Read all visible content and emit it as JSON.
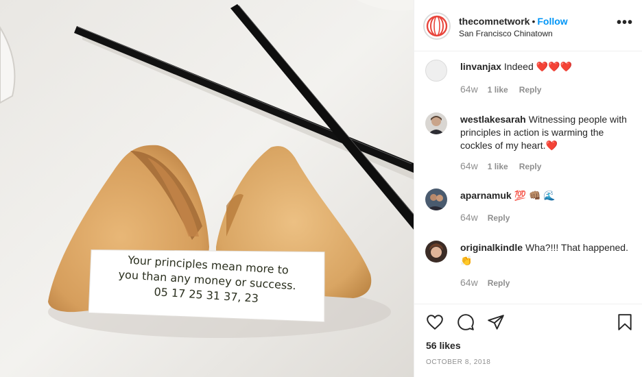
{
  "post": {
    "photo_alt": "Fortune cookie with chopsticks",
    "fortune_lines": [
      "Your principles mean more to",
      "you than any money or success.",
      "05 17 25 31 37,  23"
    ]
  },
  "header": {
    "username": "thecomnetwork",
    "separator": "•",
    "follow_label": "Follow",
    "location": "San Francisco Chinatown",
    "more_label": "•••"
  },
  "comments": [
    {
      "user": "linvanjax",
      "text": "Indeed ❤️❤️❤️",
      "age": "64w",
      "likes": "1 like",
      "reply": "Reply"
    },
    {
      "user": "westlakesarah",
      "text": "Witnessing people with principles in action is warming the cockles of my heart.❤️",
      "age": "64w",
      "likes": "1 like",
      "reply": "Reply"
    },
    {
      "user": "aparnamuk",
      "text": "💯 👊🏽 🌊",
      "age": "64w",
      "reply": "Reply"
    },
    {
      "user": "originalkindle",
      "text": "Wha?!!! That happened. 👏",
      "age": "64w",
      "reply": "Reply"
    }
  ],
  "footer": {
    "likes": "56 likes",
    "date": "OCTOBER 8, 2018"
  },
  "icons": {
    "like": "heart-icon",
    "comment": "comment-bubble-icon",
    "share": "paper-plane-icon",
    "save": "bookmark-icon"
  },
  "colors": {
    "link_blue": "#0095f6",
    "meta_grey": "#8e8e8e",
    "text": "#262626"
  }
}
